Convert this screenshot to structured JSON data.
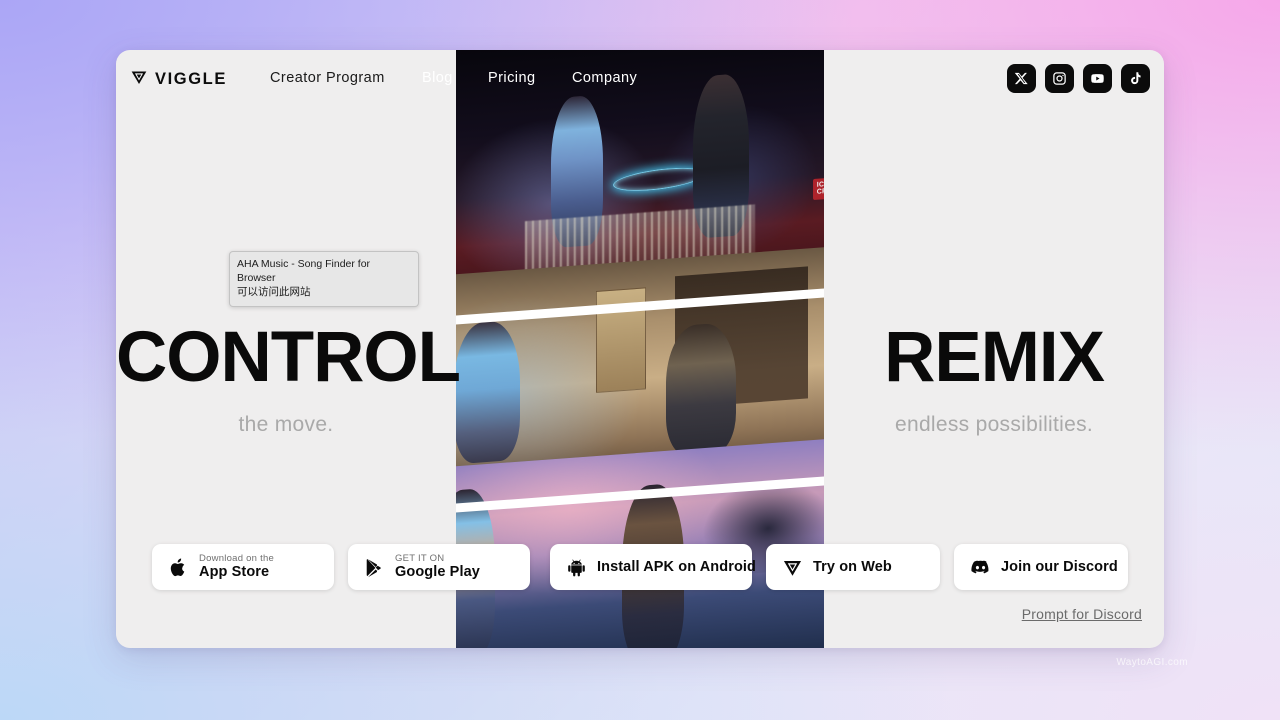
{
  "header": {
    "logo_text": "VIGGLE",
    "logo_icon": "viggle-chevron-logo",
    "nav": [
      {
        "label": "Creator Program",
        "icon": ""
      },
      {
        "label": "Blog",
        "icon": ""
      },
      {
        "label": "Pricing",
        "icon": ""
      },
      {
        "label": "Company",
        "icon": ""
      }
    ],
    "socials": [
      {
        "name": "x-icon",
        "label": "X"
      },
      {
        "name": "instagram-icon",
        "label": "Instagram"
      },
      {
        "name": "youtube-icon",
        "label": "YouTube"
      },
      {
        "name": "tiktok-icon",
        "label": "TikTok"
      }
    ]
  },
  "hero_left": {
    "title": "CONTROL",
    "subtitle": "the move."
  },
  "hero_right": {
    "title": "REMIX",
    "subtitle": "endless possibilities."
  },
  "tooltip": {
    "line1": "AHA Music - Song Finder for Browser",
    "line2": "可以访问此网站"
  },
  "buttons": {
    "app_store": {
      "small": "Download on the",
      "big": "App Store",
      "icon": "apple-icon"
    },
    "google_play": {
      "small": "GET IT ON",
      "big": "Google Play",
      "icon": "google-play-icon"
    },
    "apk": {
      "label": "Install APK on Android",
      "icon": "android-icon"
    },
    "web": {
      "label": "Try on Web",
      "icon": "viggle-chevron-logo"
    },
    "discord": {
      "label": "Join our Discord",
      "icon": "discord-icon"
    }
  },
  "links": {
    "prompt_for_discord": "Prompt for Discord"
  },
  "watermark": "WaytoAGI.com",
  "media": {
    "panels": [
      {
        "name": "nightclub-dance-scene",
        "caption_sign": "ICE\nCREAM"
      },
      {
        "name": "interior-sepia-scene"
      },
      {
        "name": "dusk-sky-dance-scene"
      }
    ]
  },
  "colors": {
    "card_bg": "#efeeee",
    "text_primary": "#0a0a0a",
    "text_muted": "#a9a9a9",
    "social_chip": "#0b0b0b",
    "button_bg": "#ffffff"
  }
}
